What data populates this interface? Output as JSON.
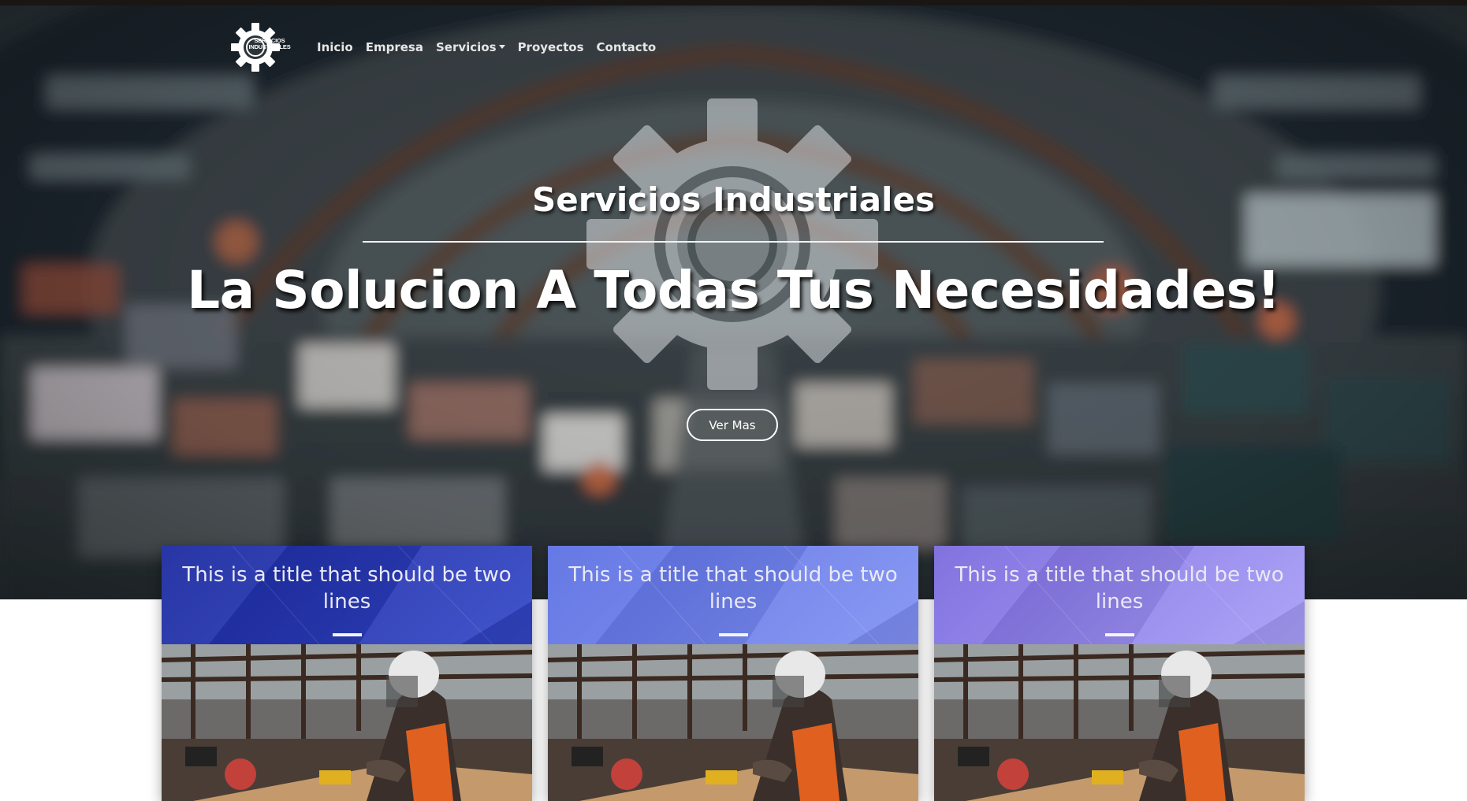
{
  "nav": {
    "brand_text": "SERVICIOS INDUSTRIALES",
    "links": [
      {
        "label": "Inicio"
      },
      {
        "label": "Empresa"
      },
      {
        "label": "Servicios",
        "dropdown": true
      },
      {
        "label": "Proyectos"
      },
      {
        "label": "Contacto"
      }
    ]
  },
  "hero": {
    "subtitle": "Servicios Industriales",
    "title": "La Solucion A Todas Tus Necesidades!",
    "button_label": "Ver Mas"
  },
  "cards": [
    {
      "title": "This is a title that should be two lines",
      "color_from": "#1f2fa8",
      "color_to": "#3b4fd0"
    },
    {
      "title": "This is a title that should be two lines",
      "color_from": "#5f74e6",
      "color_to": "#8593f3"
    },
    {
      "title": "This is a title that should be two lines",
      "color_from": "#7e6fe0",
      "color_to": "#a69cf6"
    }
  ],
  "colors": {
    "topbar": "#1a1614",
    "hero_text": "#ffffff"
  }
}
